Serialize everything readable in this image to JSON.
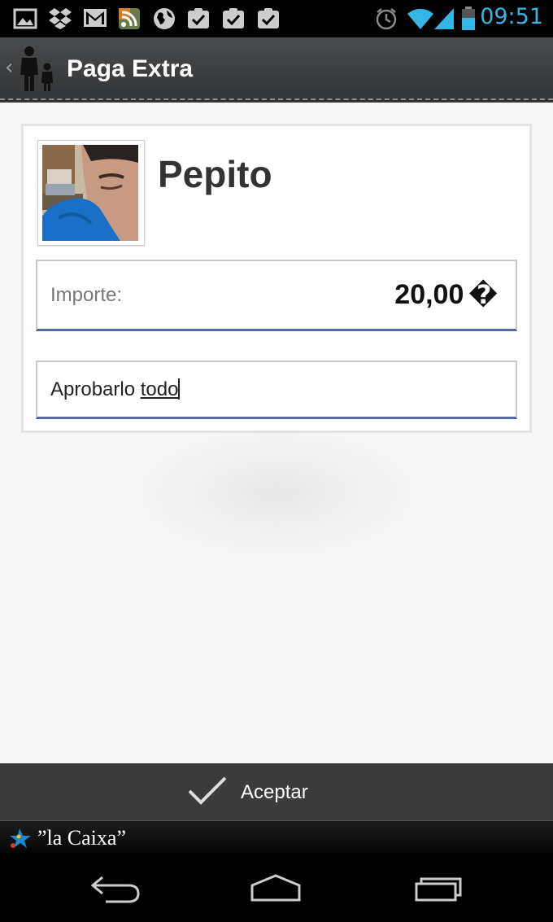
{
  "status_bar": {
    "time": "09:51",
    "icons": [
      "gallery-icon",
      "dropbox-icon",
      "gmail-icon",
      "rss-icon",
      "globe-icon",
      "task-check-icon",
      "task-check-icon",
      "task-check-icon",
      "alarm-icon",
      "wifi-icon",
      "signal-icon",
      "battery-icon"
    ],
    "accent_color": "#33b5e5"
  },
  "action_bar": {
    "title": "Paga Extra",
    "back_glyph": "‹"
  },
  "profile": {
    "name": "Pepito"
  },
  "form": {
    "amount_label": "Importe:",
    "amount_value": "20,00",
    "currency_symbol": "�",
    "concept_value_plain": "Aprobarlo ",
    "concept_value_underlined": "todo"
  },
  "accept_bar": {
    "label": "Aceptar"
  },
  "brand": {
    "name": "”la Caixa”"
  },
  "colors": {
    "field_underline": "#5a6aa0",
    "action_bar": "#3a3c3e"
  }
}
